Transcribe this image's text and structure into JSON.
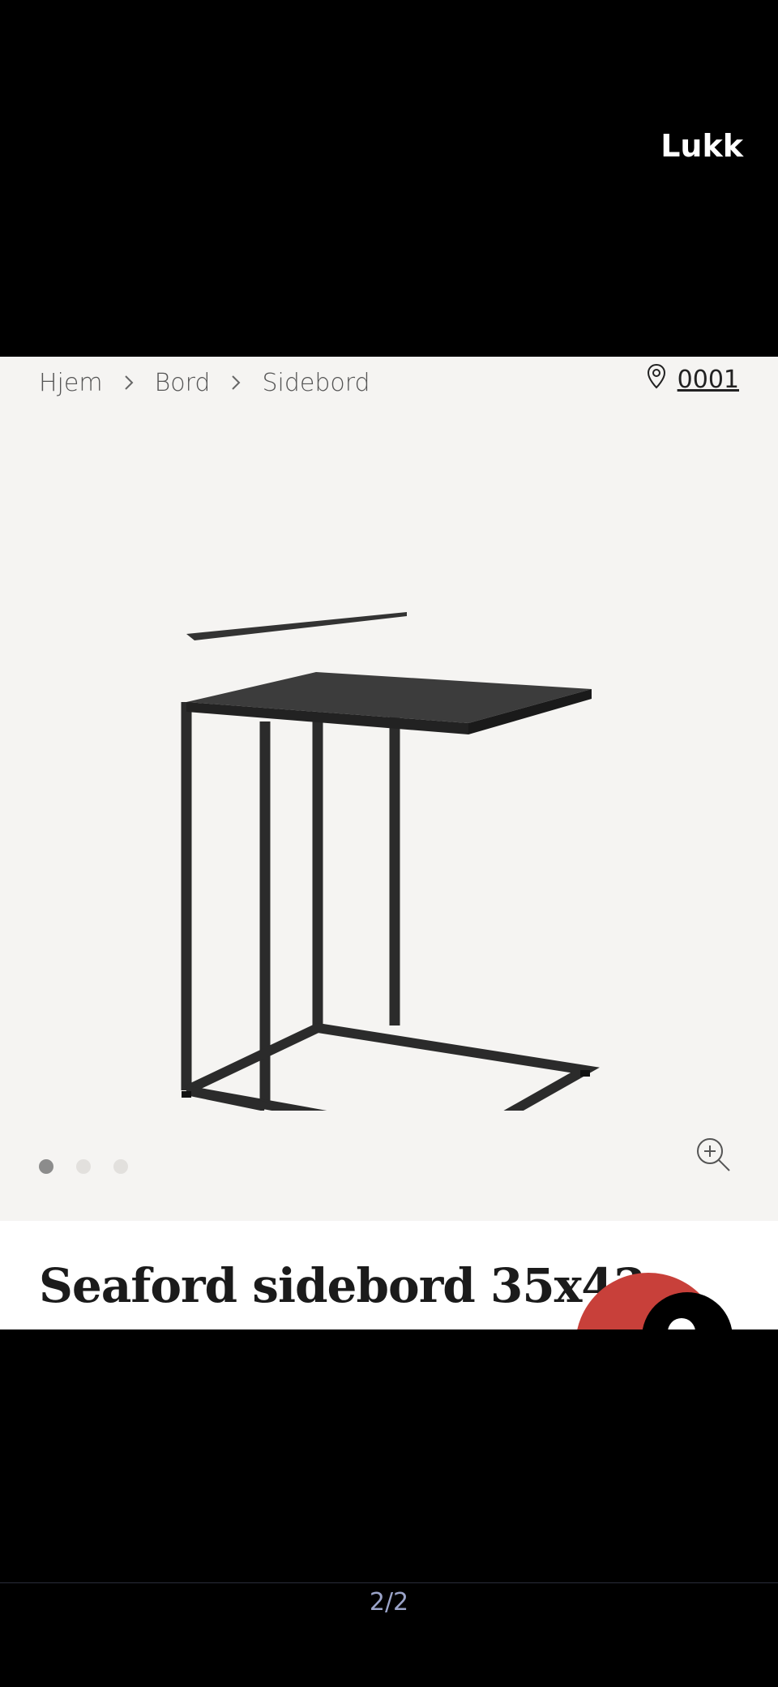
{
  "header": {
    "close_label": "Lukk"
  },
  "breadcrumb": {
    "items": [
      "Hjem",
      "Bord",
      "Sidebord"
    ]
  },
  "store": {
    "label": "0001",
    "icon": "map-pin-icon"
  },
  "gallery": {
    "total_images": 3,
    "active_index": 0
  },
  "product": {
    "title": "Seaford sidebord 35x43"
  },
  "footer": {
    "page_indicator": "2/2"
  },
  "colors": {
    "background": "#f5f4f2",
    "accent_red": "#c8403a",
    "frame": "#000000"
  }
}
